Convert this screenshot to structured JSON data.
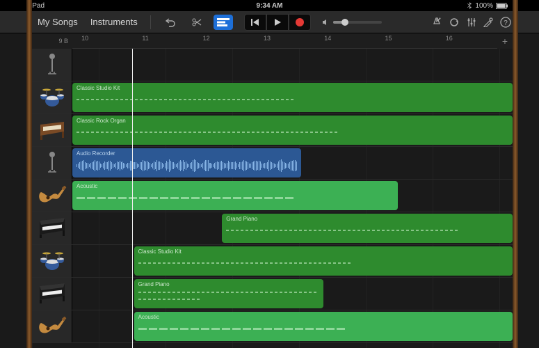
{
  "status": {
    "device": "iPad",
    "time": "9:34 AM",
    "battery_pct": "100%"
  },
  "toolbar": {
    "my_songs": "My Songs",
    "instruments": "Instruments"
  },
  "ruler": {
    "section": "B",
    "range_start": 9,
    "numbers": [
      10,
      11,
      12,
      13,
      14,
      15,
      16
    ]
  },
  "tracks": [
    {
      "instrument": "microphone",
      "regions": []
    },
    {
      "instrument": "drums",
      "regions": [
        {
          "label": "Classic Studio Kit",
          "start_pct": 0,
          "width_pct": 100,
          "color": "green",
          "pattern": "dots"
        }
      ]
    },
    {
      "instrument": "organ",
      "regions": [
        {
          "label": "Classic Rock Organ",
          "start_pct": 0,
          "width_pct": 100,
          "color": "green",
          "pattern": "dots"
        }
      ]
    },
    {
      "instrument": "microphone",
      "regions": [
        {
          "label": "Audio Recorder",
          "start_pct": 0,
          "width_pct": 52,
          "color": "blue",
          "pattern": "wave"
        }
      ]
    },
    {
      "instrument": "guitar",
      "regions": [
        {
          "label": "Acoustic",
          "start_pct": 0,
          "width_pct": 74,
          "color": "lightgreen",
          "pattern": "bars"
        }
      ]
    },
    {
      "instrument": "piano",
      "regions": [
        {
          "label": "Grand Piano",
          "start_pct": 34,
          "width_pct": 66,
          "color": "green",
          "pattern": "dots"
        }
      ]
    },
    {
      "instrument": "drums",
      "regions": [
        {
          "label": "Classic Studio Kit",
          "start_pct": 14,
          "width_pct": 86,
          "color": "green",
          "pattern": "dots"
        }
      ]
    },
    {
      "instrument": "piano",
      "regions": [
        {
          "label": "Grand Piano",
          "start_pct": 14,
          "width_pct": 43,
          "color": "green",
          "pattern": "dots"
        }
      ]
    },
    {
      "instrument": "guitar",
      "regions": [
        {
          "label": "Acoustic",
          "start_pct": 14,
          "width_pct": 86,
          "color": "lightgreen",
          "pattern": "bars"
        }
      ]
    }
  ],
  "playhead_pct": 14,
  "colors": {
    "green": "#2e8b2e",
    "lightgreen": "#3cb054",
    "blue": "#2c5894",
    "active_tool": "#1d6fd8",
    "record": "#e53935"
  }
}
